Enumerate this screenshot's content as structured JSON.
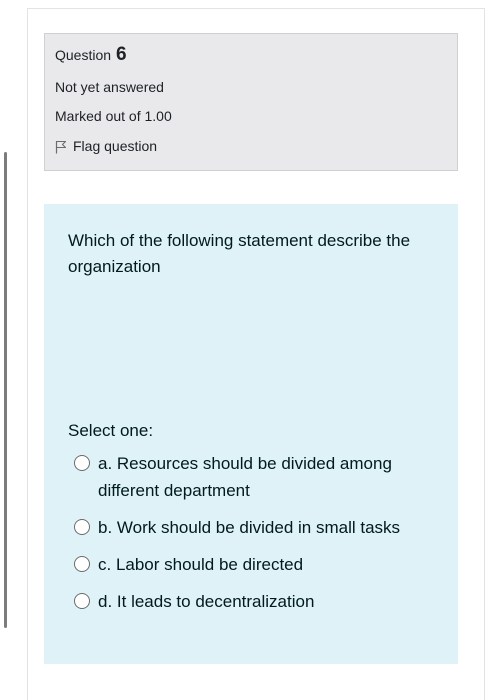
{
  "question": {
    "label": "Question",
    "number": "6",
    "state": "Not yet answered",
    "grade": "Marked out of 1.00",
    "flag_label": "Flag question"
  },
  "content": {
    "text": "Which of the following statement describe the organization",
    "prompt": "Select one:",
    "options": [
      {
        "label": "a. Resources should be divided among different department"
      },
      {
        "label": "b. Work should be divided in small tasks"
      },
      {
        "label": "c. Labor should be directed"
      },
      {
        "label": "d.  It leads to decentralization"
      }
    ]
  },
  "colors": {
    "info_background": "#e9e9eb",
    "content_background": "#def2f8"
  },
  "icons": {
    "flag": "flag-icon",
    "radio": "radio-unchecked-icon"
  }
}
